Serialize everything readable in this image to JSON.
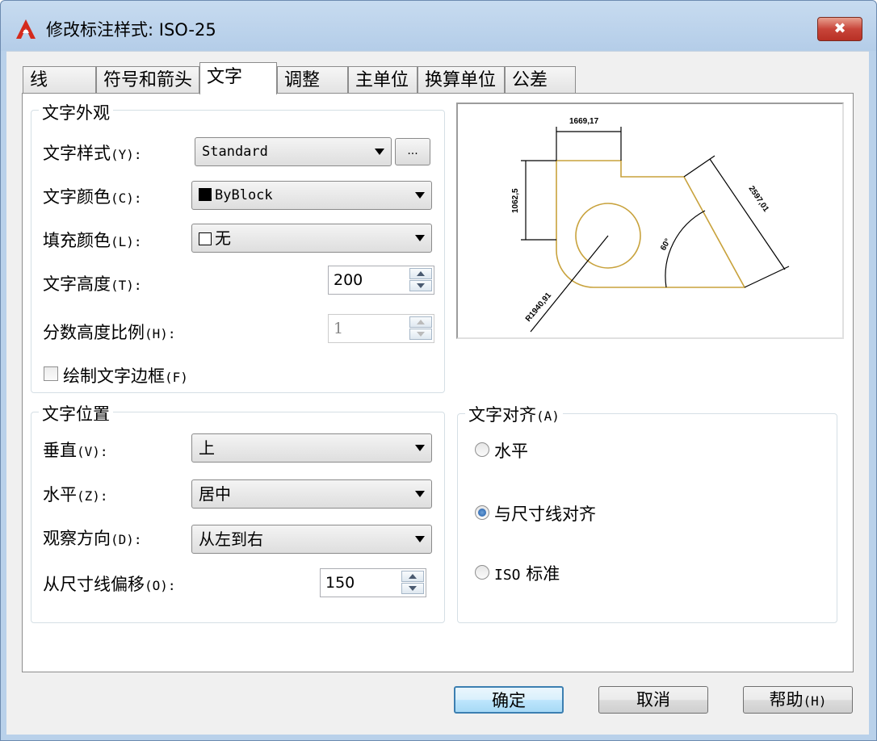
{
  "window": {
    "title": "修改标注样式: ISO-25",
    "close_glyph": "✖"
  },
  "tabs": [
    {
      "label": "线"
    },
    {
      "label": "符号和箭头"
    },
    {
      "label": "文字"
    },
    {
      "label": "调整"
    },
    {
      "label": "主单位"
    },
    {
      "label": "换算单位"
    },
    {
      "label": "公差"
    }
  ],
  "active_tab": "文字",
  "appearance": {
    "title": "文字外观",
    "style": {
      "label": "文字样式",
      "hotkey": "(Y):",
      "value": "Standard",
      "more": "..."
    },
    "color": {
      "label": "文字颜色",
      "hotkey": "(C):",
      "value": "ByBlock",
      "swatch": "#000000"
    },
    "fill": {
      "label": "填充颜色",
      "hotkey": "(L):",
      "value": "无",
      "swatch": "#ffffff"
    },
    "height": {
      "label": "文字高度",
      "hotkey": "(T):",
      "value": "200"
    },
    "fraction": {
      "label": "分数高度比例",
      "hotkey": "(H):",
      "value": "1"
    },
    "frame": {
      "label": "绘制文字边框",
      "hotkey": "(F)",
      "checked": false
    }
  },
  "placement": {
    "title": "文字位置",
    "vertical": {
      "label": "垂直",
      "hotkey": "(V):",
      "value": "上"
    },
    "horizontal": {
      "label": "水平",
      "hotkey": "(Z):",
      "value": "居中"
    },
    "view_direction": {
      "label": "观察方向",
      "hotkey": "(D):",
      "value": "从左到右"
    },
    "offset": {
      "label": "从尺寸线偏移",
      "hotkey": "(O):",
      "value": "150"
    }
  },
  "alignment": {
    "title": "文字对齐",
    "hotkey": "(A)",
    "options": [
      {
        "label": "水平",
        "selected": false
      },
      {
        "label": "与尺寸线对齐",
        "selected": true
      },
      {
        "label": "ISO",
        "suffix": "标准",
        "selected": false
      }
    ]
  },
  "preview": {
    "dims": [
      "1669,17",
      "1062,5",
      "2597,01",
      "60°",
      "R1940,91"
    ],
    "shape_color": "#c8a23c"
  },
  "buttons": {
    "ok": "确定",
    "cancel": "取消",
    "help": "帮助",
    "help_hotkey": "(H)"
  }
}
